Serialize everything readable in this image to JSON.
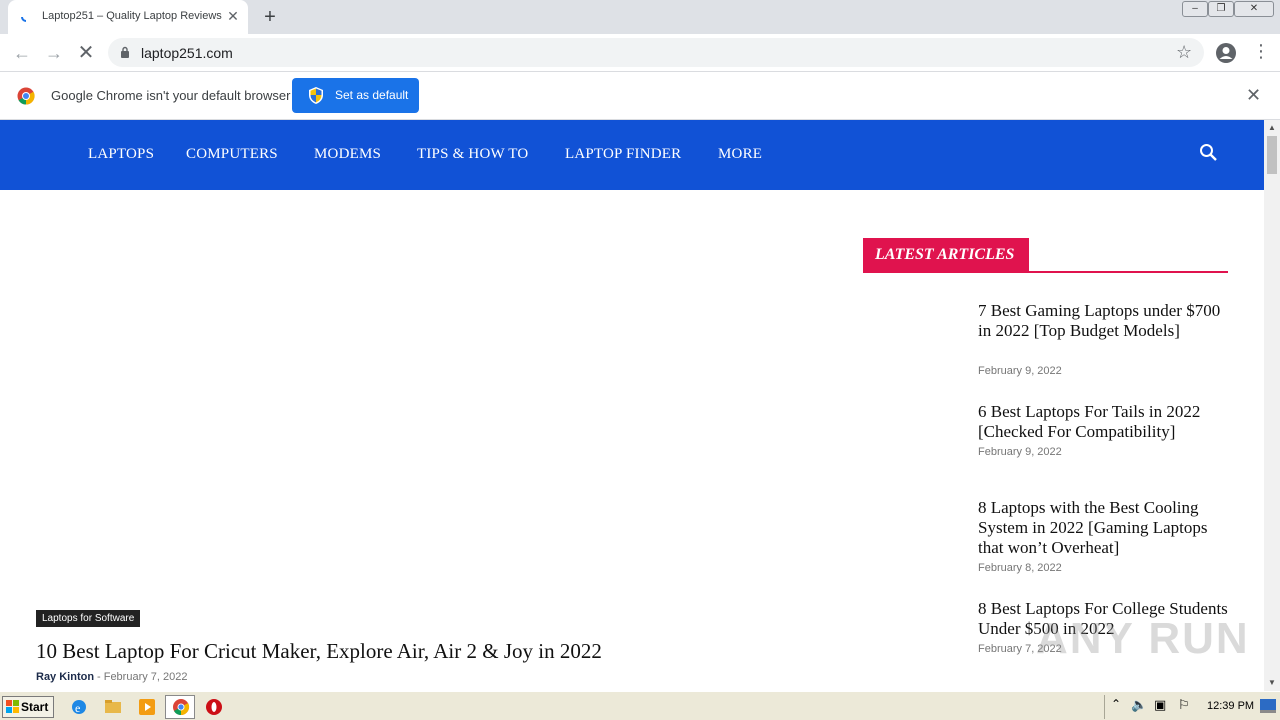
{
  "browser": {
    "tab_title": "Laptop251 – Quality Laptop Reviews",
    "tab_close": "✕",
    "new_tab": "+",
    "url": "laptop251.com"
  },
  "infobar": {
    "message": "Google Chrome isn't your default browser",
    "set_default_label": "Set as default",
    "close": "✕"
  },
  "site": {
    "nav": [
      "LAPTOPS",
      "COMPUTERS",
      "MODEMS",
      "TIPS & HOW TO",
      "LAPTOP FINDER",
      "MORE"
    ],
    "accent": "#1152d6",
    "sidebar_accent": "#e0134e"
  },
  "featured": {
    "category": "Laptops for Software",
    "title": "10 Best Laptop For Cricut Maker, Explore Air, Air 2 & Joy in 2022",
    "author": "Ray Kinton",
    "date": "- February 7, 2022"
  },
  "sidebar": {
    "heading": "LATEST ARTICLES",
    "articles": [
      {
        "title": "7 Best Gaming Laptops under $700 in 2022 [Top Budget Models]",
        "date": "February 9, 2022"
      },
      {
        "title": "6 Best Laptops For Tails in 2022 [Checked For Compatibility]",
        "date": "February 9, 2022"
      },
      {
        "title": "8 Laptops with the Best Cooling System in 2022 [Gaming Laptops that won’t Overheat]",
        "date": "February 8, 2022"
      },
      {
        "title": "8 Best Laptops For College Students Under $500 in 2022",
        "date": "February 7, 2022"
      }
    ]
  },
  "watermark": "ANY RUN",
  "taskbar": {
    "start_label": "Start",
    "clock": "12:39 PM"
  }
}
